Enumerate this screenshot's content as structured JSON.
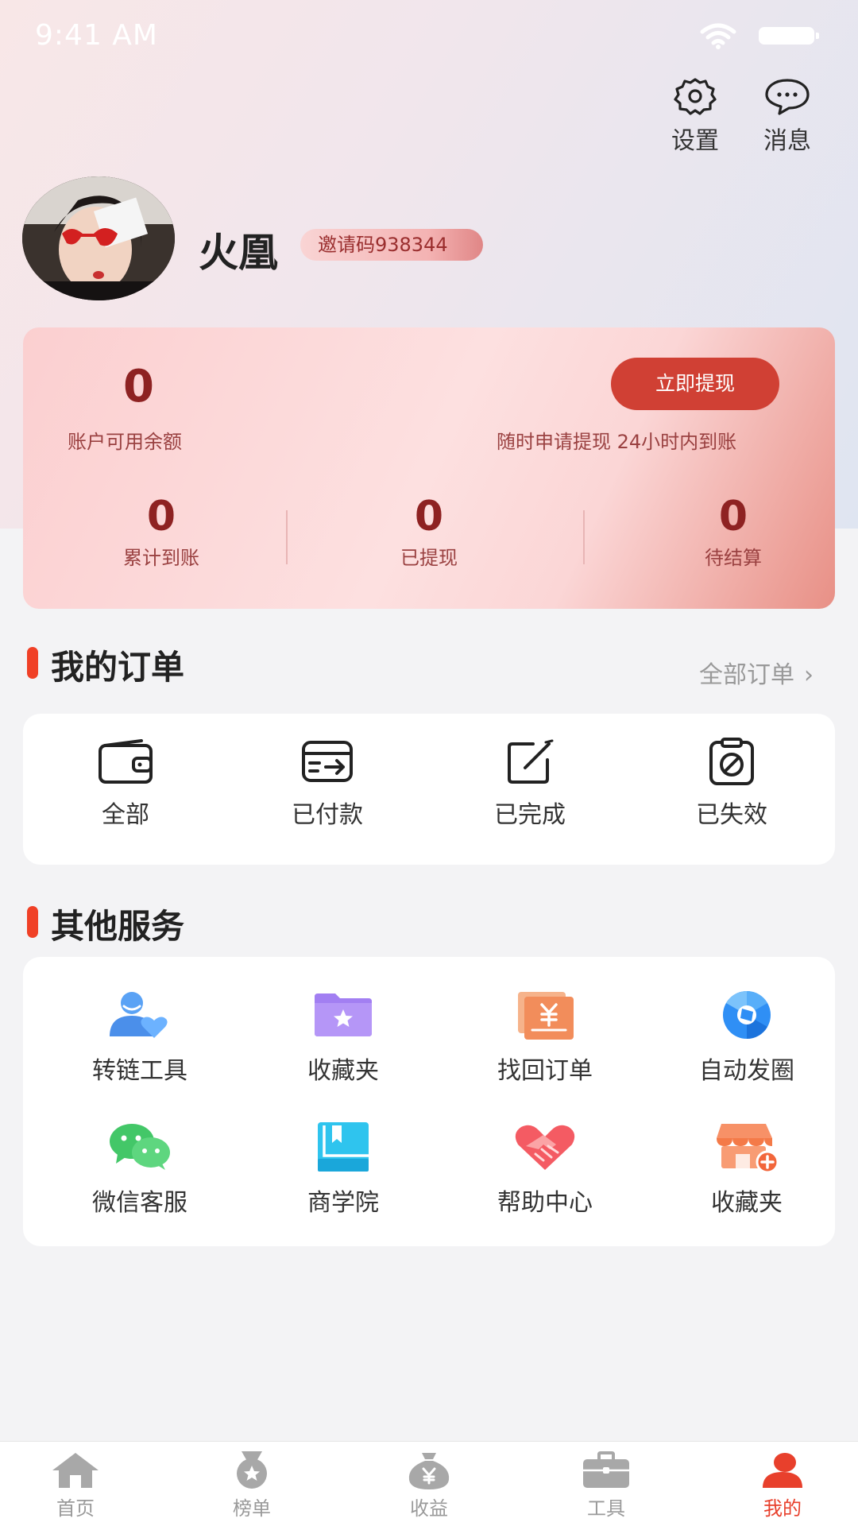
{
  "status_bar": {
    "time": "9:41 AM"
  },
  "header": {
    "settings_label": "设置",
    "messages_label": "消息"
  },
  "profile": {
    "name": "火凰",
    "invite_code": "邀请码938344"
  },
  "wallet": {
    "balance": "0",
    "balance_label": "账户可用余额",
    "withdraw_button": "立即提现",
    "withdraw_tip": "随时申请提现 24小时内到账",
    "stats": [
      {
        "value": "0",
        "label": "累计到账"
      },
      {
        "value": "0",
        "label": "已提现"
      },
      {
        "value": "0",
        "label": "待结算"
      }
    ],
    "colors": {
      "accent": "#d04034",
      "value": "#8e2222"
    }
  },
  "orders": {
    "title": "我的订单",
    "see_all": "全部订单",
    "items": [
      {
        "label": "全部",
        "icon": "wallet-icon"
      },
      {
        "label": "已付款",
        "icon": "paid-card-icon"
      },
      {
        "label": "已完成",
        "icon": "edit-check-icon"
      },
      {
        "label": "已失效",
        "icon": "expired-clipboard-icon"
      }
    ]
  },
  "services": {
    "title": "其他服务",
    "items": [
      {
        "label": "转链工具",
        "icon": "user-heart-icon"
      },
      {
        "label": "收藏夹",
        "icon": "star-folder-icon"
      },
      {
        "label": "找回订单",
        "icon": "receipt-yen-icon"
      },
      {
        "label": "自动发圈",
        "icon": "camera-aperture-icon"
      },
      {
        "label": "微信客服",
        "icon": "wechat-icon"
      },
      {
        "label": "商学院",
        "icon": "book-icon"
      },
      {
        "label": "帮助中心",
        "icon": "handshake-icon"
      },
      {
        "label": "收藏夹",
        "icon": "store-add-icon"
      }
    ]
  },
  "tabbar": {
    "active_color": "#e8402c",
    "items": [
      {
        "label": "首页",
        "icon": "home-icon"
      },
      {
        "label": "榜单",
        "icon": "medal-icon"
      },
      {
        "label": "收益",
        "icon": "money-bag-icon"
      },
      {
        "label": "工具",
        "icon": "toolbox-icon"
      },
      {
        "label": "我的",
        "icon": "user-icon",
        "active": true
      }
    ]
  }
}
